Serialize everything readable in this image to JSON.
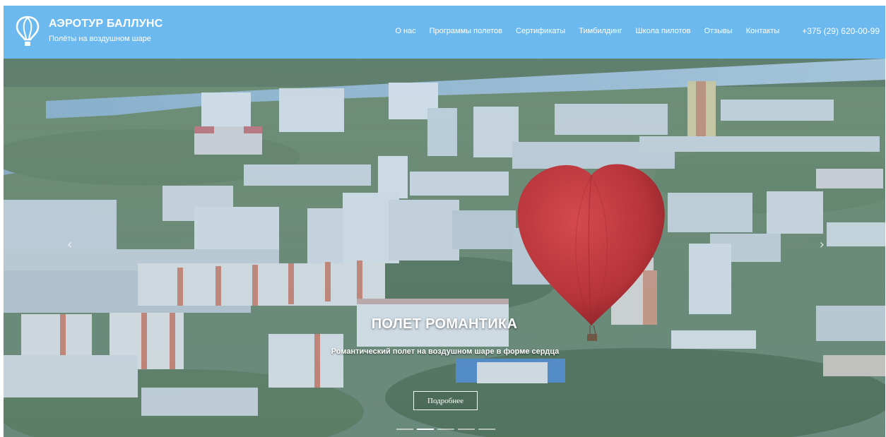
{
  "brand": {
    "title": "АЭРОТУР БАЛЛУНС",
    "subtitle": "Полёты на воздушном шаре",
    "icon": "balloon-icon"
  },
  "nav": {
    "items": [
      {
        "label": "О нас"
      },
      {
        "label": "Программы полетов"
      },
      {
        "label": "Сертификаты"
      },
      {
        "label": "Тимбилдинг"
      },
      {
        "label": "Школа пилотов"
      },
      {
        "label": "Отзывы"
      },
      {
        "label": "Контакты"
      }
    ],
    "phone": "+375 (29) 620-00-99"
  },
  "slider": {
    "title": "ПОЛЕТ РОМАНТИКА",
    "subtitle": "Романтический полет на воздушном шаре в форме сердца",
    "button_label": "Подробнее",
    "prev_icon": "chevron-left-icon",
    "next_icon": "chevron-right-icon",
    "slide_count": 5,
    "active_slide": 2
  },
  "colors": {
    "header_bg": "#6bb9ee",
    "heart_balloon": "#c23b40"
  }
}
